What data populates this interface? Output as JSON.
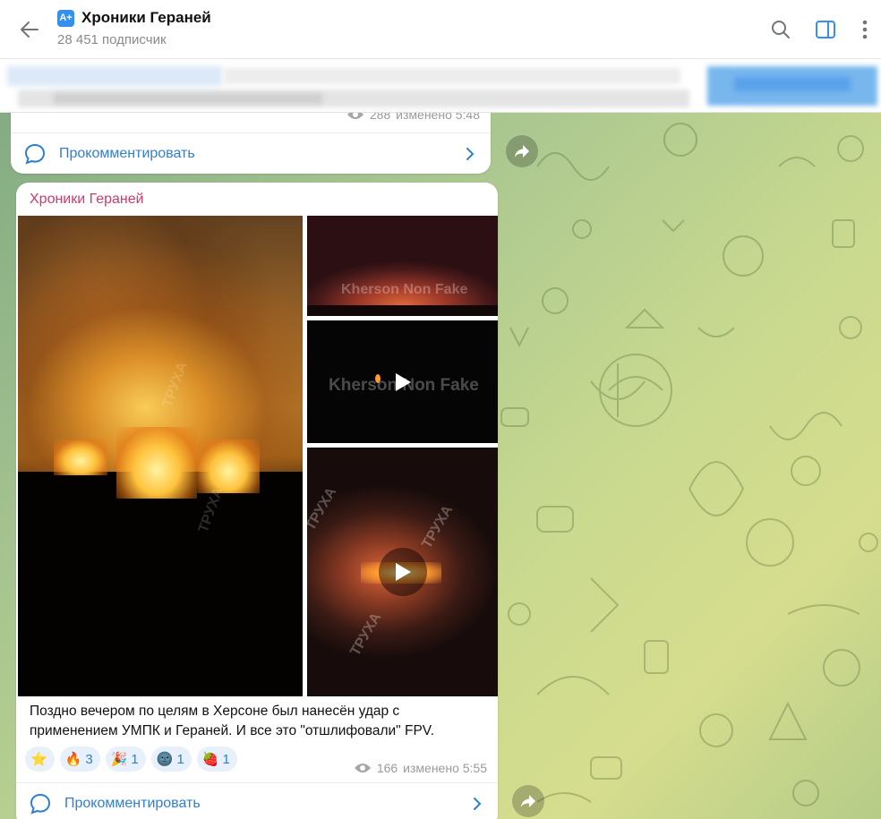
{
  "header": {
    "channel_badge": "A+",
    "channel_title": "Хроники Гераней",
    "subscribers": "28 451 подписчик",
    "icons": [
      "back-arrow-icon",
      "search-icon",
      "sidebar-toggle-icon",
      "more-vert-icon"
    ]
  },
  "colors": {
    "accent": "#3390ec",
    "link": "#2f7fd0",
    "sender": "#d2386b",
    "reaction_bg": "#e8f0fb"
  },
  "messages": [
    {
      "views": "288",
      "edited": "изменено 5:48",
      "comment_label": "Прокомментировать"
    },
    {
      "sender": "Хроники Гераней",
      "media": [
        {
          "type": "photo"
        },
        {
          "type": "photo",
          "watermark": "Kherson Non Fake"
        },
        {
          "type": "video",
          "watermark": "Kherson Non Fake"
        },
        {
          "type": "video",
          "watermark": "ТРУХА"
        }
      ],
      "caption_line1": "Поздно вечером по целям в Херсоне был нанесён удар с",
      "caption_line2": "применением УМПК и Гераней. И все это \"отшлифовали\" FPV.",
      "reactions": [
        {
          "emoji": "⭐",
          "count": ""
        },
        {
          "emoji": "🔥",
          "count": "3"
        },
        {
          "emoji": "🎉",
          "count": "1"
        },
        {
          "emoji": "🌚",
          "count": "1"
        },
        {
          "emoji": "🍓",
          "count": "1"
        }
      ],
      "views": "166",
      "edited": "изменено 5:55",
      "comment_label": "Прокомментировать"
    }
  ]
}
